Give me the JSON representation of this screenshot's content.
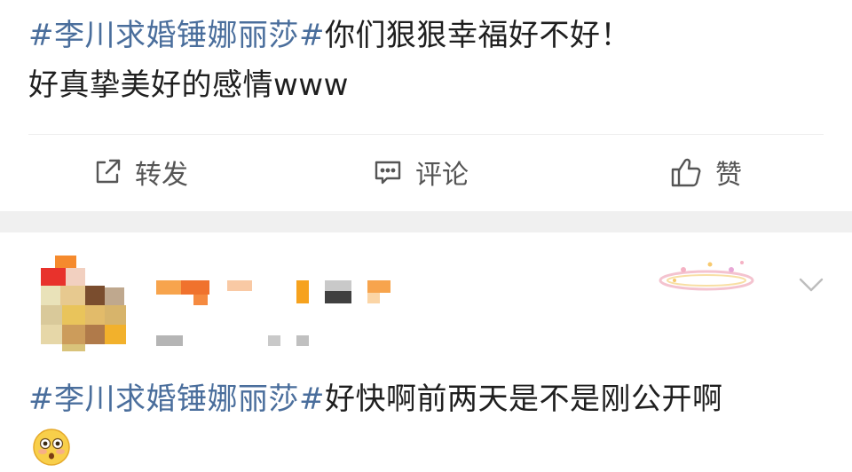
{
  "post1": {
    "hashtag": "#李川求婚锤娜丽莎#",
    "text_line1_rest": "你们狠狠幸福好不好！",
    "text_line2": "好真挚美好的感情www"
  },
  "actions": {
    "repost_label": "转发",
    "comment_label": "评论",
    "like_label": "赞"
  },
  "post2": {
    "hashtag": "#李川求婚锤娜丽莎#",
    "text_rest": "好快啊前两天是不是刚公开啊",
    "emoji_name": "flushed-face-emoji"
  },
  "colors": {
    "hashtag": "#4a6e9c",
    "action_text": "#555555",
    "band": "#f0f0f0"
  }
}
